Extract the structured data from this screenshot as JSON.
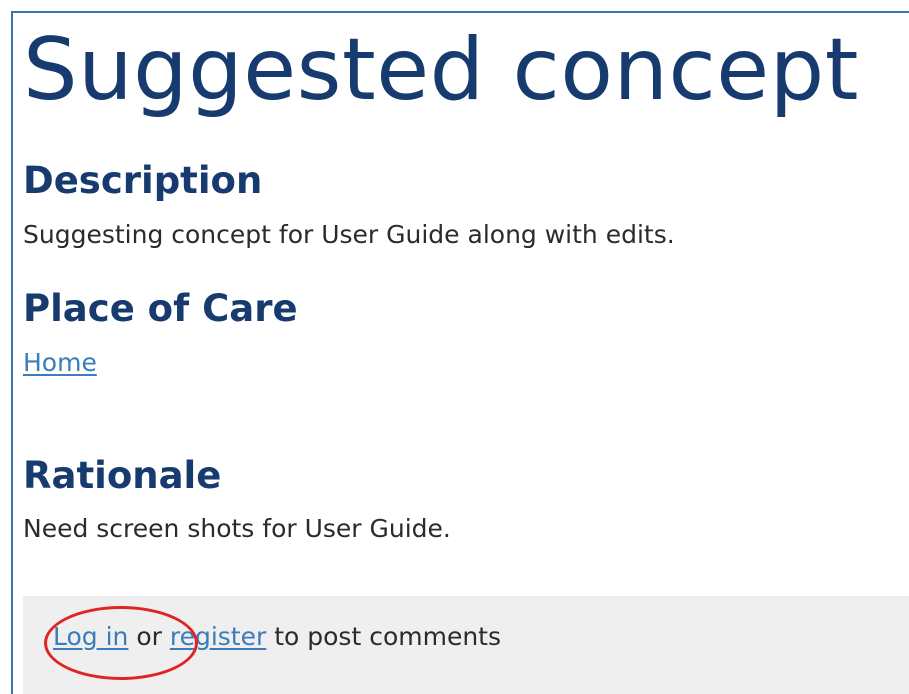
{
  "page": {
    "title": "Suggested concept"
  },
  "sections": {
    "description": {
      "heading": "Description",
      "text": "Suggesting concept for User Guide along with edits."
    },
    "place_of_care": {
      "heading": "Place of Care",
      "link_text": "Home"
    },
    "rationale": {
      "heading": "Rationale",
      "text": "Need screen shots for User Guide."
    }
  },
  "comments": {
    "login_link": "Log in",
    "or_text": " or ",
    "register_link": "register",
    "suffix_text": " to post comments"
  },
  "colors": {
    "title": "#173b6e",
    "link": "#3a7cbc",
    "frame_border": "#3f6fb5",
    "annotation": "#e02424",
    "comments_bg": "#efefef"
  }
}
